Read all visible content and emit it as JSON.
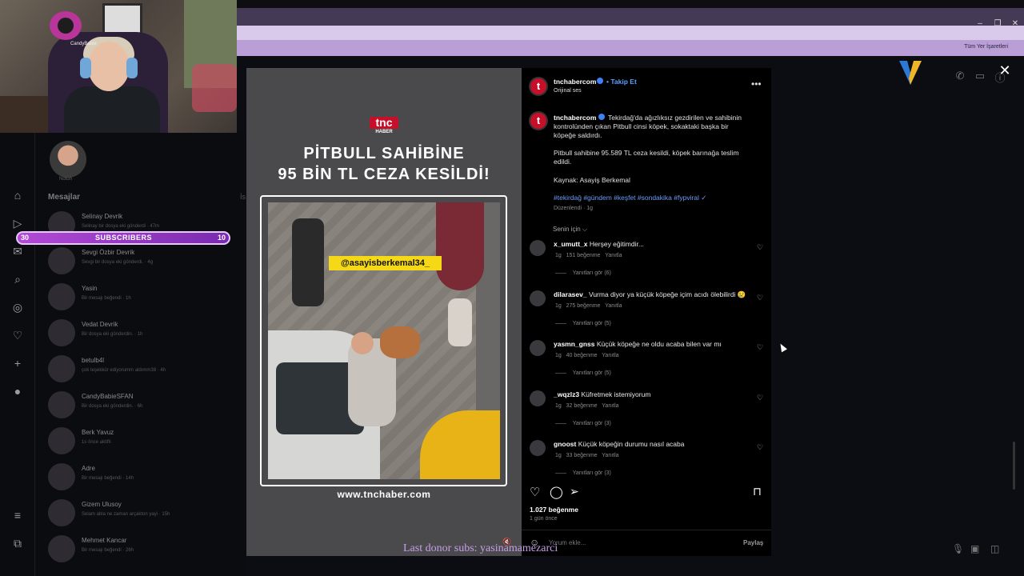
{
  "browser": {
    "bookmarks_label": "Tüm Yer İşaretleri",
    "window_buttons": [
      "–",
      "❐",
      "✕"
    ]
  },
  "stream": {
    "subscribers_label": "SUBSCRIBERS",
    "subscribers_current": "30",
    "subscribers_goal": "10",
    "donor_text": "Last donor subs: yasinamamezarci",
    "cam_tag": "CandyBabie"
  },
  "sidebar": {
    "profile_note": "Notun",
    "heading": "Mesajlar",
    "requests": "İs",
    "conversations": [
      {
        "name": "Selinay Devrik",
        "sub": "Selinay bir dosya eki gönderdi · 47m"
      },
      {
        "name": "Sevgi Özbir Devrik",
        "sub": "Sevgi bir dosya eki gönderdi. · 4g"
      },
      {
        "name": "Yasin",
        "sub": "Bir mesajı beğendi · 1h"
      },
      {
        "name": "Vedat Devrik",
        "sub": "Bir dosya eki gönderdin. · 1h"
      },
      {
        "name": "betulb4l",
        "sub": "çok teşekkür ediyorumm aldımm38 · 4h"
      },
      {
        "name": "CandyBabieSFAN",
        "sub": "Bir dosya eki gönderdin. · 6h"
      },
      {
        "name": "Berk Yavuz",
        "sub": "1s önce aktifti"
      },
      {
        "name": "Adre",
        "sub": "Bir mesajı beğendi · 14h"
      },
      {
        "name": "Gizem Ulusoy",
        "sub": "Selam abla ne zaman arçakton yayi · 15h"
      },
      {
        "name": "Mehmet Kancar",
        "sub": "Bir mesajı beğendi · 26h"
      }
    ]
  },
  "post_image": {
    "brand_top": "tnc",
    "brand_bottom": "HABER",
    "headline_line1": "PİTBULL SAHİBİNE",
    "headline_line2": "95 BİN TL CEZA KESİLDİ!",
    "watermark": "@asayisberkemal34_",
    "site_url": "www.tnchaber.com"
  },
  "post": {
    "username": "tnchabercom",
    "follow": "• Takip Et",
    "audio": "Orijinal ses",
    "caption_line1": "Tekirdağ'da ağızlıksız gezdirilen ve sahibinin",
    "caption_line2": "kontrolünden çıkan Pitbull cinsi köpek, sokaktaki başka bir",
    "caption_line3": "köpeğe saldırdı.",
    "caption_line4": "Pitbull sahibine 95.589 TL ceza kesildi, köpek barınağa teslim",
    "caption_line5": "edildi.",
    "caption_line6": "Kaynak: Asayiş Berkemal",
    "tags": "#tekirdağ #gündem #keşfet #sondakika #fypviral ✓",
    "edited": "Düzenlendi · 1g",
    "for_you": "Senin için ⌵",
    "likes": "1.027 beğenme",
    "posted": "1 gün önce",
    "comment_placeholder": "Yorum ekle...",
    "post_button": "Paylaş"
  },
  "comments": [
    {
      "user": "x_umutt_x",
      "text": "Herşey eğitimdir...",
      "time": "1g",
      "likes": "151 beğenme",
      "reply": "Yanıtla",
      "replies": "Yanıtları gör (6)"
    },
    {
      "user": "dilarasev_",
      "text": "Vurma diyor ya küçük köpeğe içim acıdı ölebilirdi 😢",
      "time": "1g",
      "likes": "275 beğenme",
      "reply": "Yanıtla",
      "replies": "Yanıtları gör (5)"
    },
    {
      "user": "yasmn_gnss",
      "text": "Küçük köpeğe ne oldu acaba bilen var mı",
      "time": "1g",
      "likes": "40 beğenme",
      "reply": "Yanıtla",
      "replies": "Yanıtları gör (5)"
    },
    {
      "user": "_wqzlz3",
      "text": "Küfretmek istemiyorum",
      "time": "1g",
      "likes": "32 beğenme",
      "reply": "Yanıtla",
      "replies": "Yanıtları gör (3)"
    },
    {
      "user": "gnoost",
      "text": "Küçük köpeğin durumu nasıl acaba",
      "time": "1g",
      "likes": "33 beğenme",
      "reply": "Yanıtla",
      "replies": "Yanıtları gör (3)"
    }
  ],
  "colors": {
    "accent_blue": "#5aa2ff",
    "brand_red": "#c6102a",
    "subs_purple": "#b24ad6",
    "tag_yellow": "#f5d816"
  }
}
